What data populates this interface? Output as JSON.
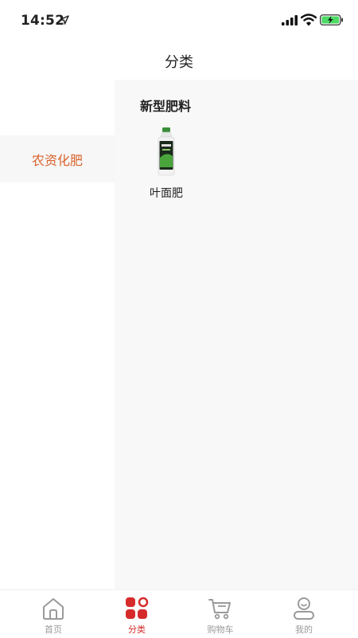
{
  "status": {
    "time": "14:52"
  },
  "header": {
    "title": "分类"
  },
  "sidebar": {
    "items": [
      {
        "label": "农资化肥",
        "active": true
      }
    ]
  },
  "content": {
    "section_title": "新型肥料",
    "products": [
      {
        "name": "叶面肥"
      }
    ]
  },
  "tabbar": {
    "tabs": [
      {
        "label": "首页",
        "icon": "home-icon"
      },
      {
        "label": "分类",
        "icon": "category-icon",
        "active": true
      },
      {
        "label": "购物车",
        "icon": "cart-icon"
      },
      {
        "label": "我的",
        "icon": "user-icon"
      }
    ]
  },
  "colors": {
    "accent": "#d9632c",
    "tab_active": "#d62b2b",
    "tab_inactive": "#999999"
  }
}
